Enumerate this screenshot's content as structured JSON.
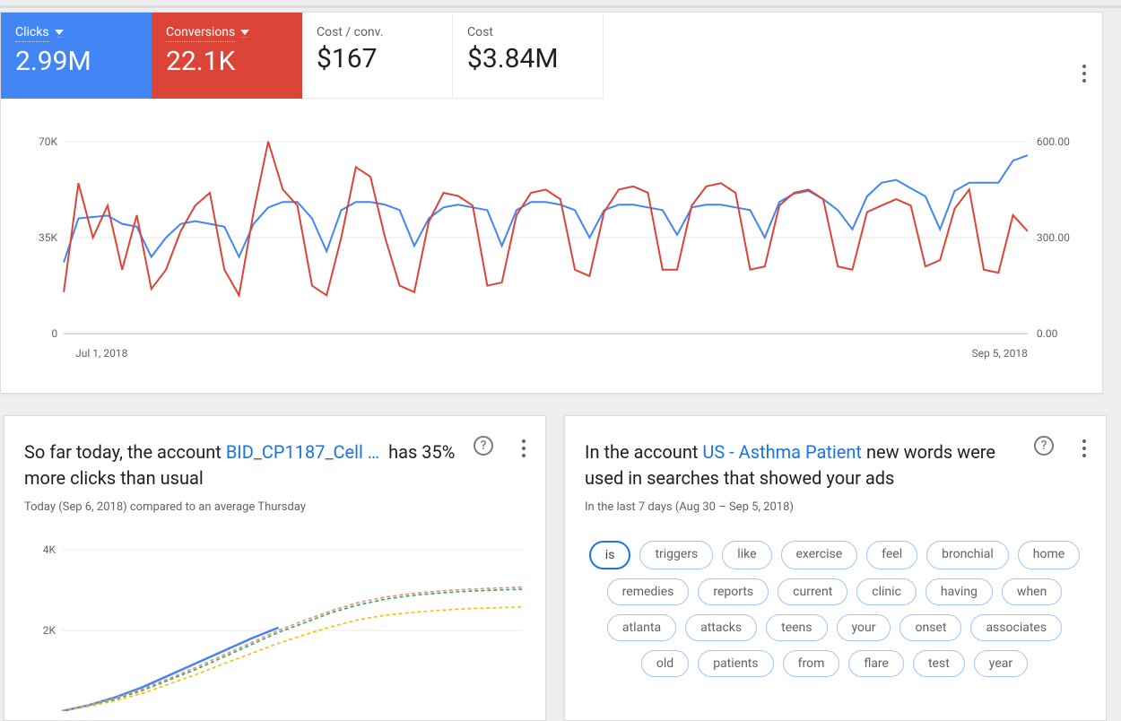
{
  "metrics": [
    {
      "label": "Clicks",
      "value": "2.99M",
      "style": "active-blue",
      "dropdown": true
    },
    {
      "label": "Conversions",
      "value": "22.1K",
      "style": "active-red",
      "dropdown": true
    },
    {
      "label": "Cost / conv.",
      "value": "$167",
      "style": "plain",
      "dropdown": false
    },
    {
      "label": "Cost",
      "value": "$3.84M",
      "style": "plain",
      "dropdown": false
    }
  ],
  "chart_data": {
    "type": "line",
    "xlabel_start": "Jul 1, 2018",
    "xlabel_end": "Sep 5, 2018",
    "left_axis": {
      "ticks": [
        "0",
        "35K",
        "70K"
      ],
      "series_name": "Clicks"
    },
    "right_axis": {
      "ticks": [
        "0.00",
        "300.00",
        "600.00"
      ],
      "series_name": "Conversions"
    },
    "series": [
      {
        "name": "Clicks",
        "axis": "left",
        "color": "#4285f4",
        "values": [
          26000,
          42000,
          42500,
          43000,
          40000,
          39000,
          28000,
          35000,
          40000,
          41000,
          40000,
          39000,
          28000,
          40000,
          46000,
          48000,
          48000,
          42000,
          30000,
          45000,
          48000,
          48000,
          47000,
          45000,
          32000,
          42000,
          46000,
          47000,
          46000,
          45000,
          32000,
          45000,
          48000,
          48000,
          47000,
          45000,
          35000,
          45000,
          47000,
          47000,
          46000,
          45000,
          36000,
          46000,
          47000,
          47000,
          46000,
          45000,
          35000,
          48000,
          51000,
          52000,
          49000,
          45000,
          38000,
          50000,
          55000,
          56000,
          53000,
          50000,
          38000,
          52000,
          55000,
          55000,
          55000,
          63000,
          65000
        ]
      },
      {
        "name": "Conversions",
        "axis": "right",
        "color": "#db4437",
        "values": [
          130,
          470,
          300,
          400,
          200,
          370,
          140,
          200,
          320,
          400,
          440,
          200,
          120,
          380,
          600,
          450,
          400,
          150,
          120,
          300,
          520,
          490,
          300,
          150,
          130,
          350,
          440,
          430,
          400,
          150,
          160,
          370,
          440,
          450,
          420,
          200,
          180,
          380,
          450,
          460,
          440,
          200,
          200,
          400,
          460,
          470,
          440,
          200,
          210,
          400,
          440,
          450,
          420,
          210,
          200,
          380,
          400,
          420,
          400,
          210,
          230,
          390,
          450,
          200,
          190,
          370,
          320
        ]
      }
    ]
  },
  "insight_left": {
    "headline_pre": "So far today, the account ",
    "account": "BID_CP1187_Cell …",
    "headline_post": "has 35% more clicks than usual",
    "subtext": "Today (Sep 6, 2018) compared to an average Thursday",
    "mini_chart": {
      "type": "line",
      "y_ticks": [
        "2K",
        "4K"
      ],
      "today": [
        0,
        150,
        350,
        600,
        900,
        1200,
        1500,
        1800,
        2070
      ],
      "avg": [
        0,
        150,
        300,
        520,
        780,
        1050,
        1350,
        1650,
        1950,
        2200,
        2450,
        2640,
        2780,
        2870,
        2930,
        2970,
        3000,
        3020
      ],
      "p25": [
        0,
        120,
        260,
        450,
        680,
        920,
        1180,
        1430,
        1680,
        1900,
        2100,
        2270,
        2380,
        2450,
        2500,
        2540,
        2560,
        2580
      ],
      "p75": [
        0,
        160,
        330,
        560,
        820,
        1100,
        1400,
        1700,
        2000,
        2260,
        2500,
        2700,
        2830,
        2920,
        2980,
        3020,
        3050,
        3070
      ]
    }
  },
  "insight_right": {
    "headline_pre": "In the account ",
    "account": "US - Asthma Patient",
    "headline_post": "new words were used in searches that showed your ads",
    "subtext": "In the last 7 days (Aug 30 – Sep 5, 2018)",
    "selected_word": "is",
    "words": [
      "is",
      "triggers",
      "like",
      "exercise",
      "feel",
      "bronchial",
      "home",
      "remedies",
      "reports",
      "current",
      "clinic",
      "having",
      "when",
      "atlanta",
      "attacks",
      "teens",
      "your",
      "onset",
      "associates",
      "old",
      "patients",
      "from",
      "flare",
      "test",
      "year"
    ]
  }
}
